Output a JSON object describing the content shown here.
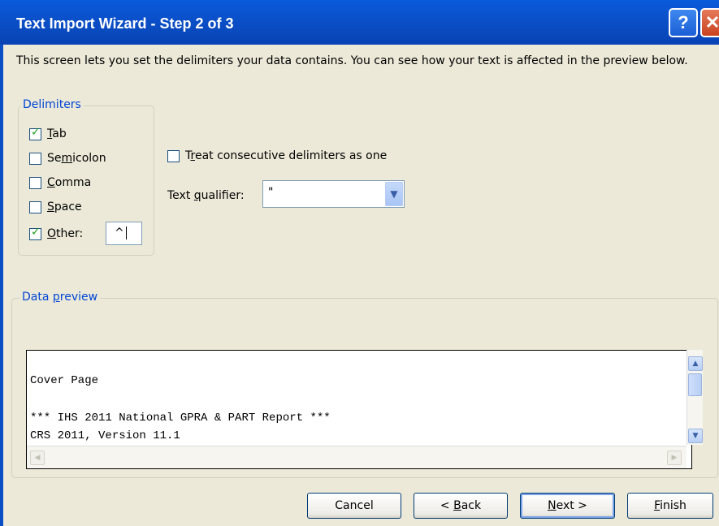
{
  "window": {
    "title": "Text Import Wizard - Step 2 of 3",
    "help_glyph": "?",
    "close_glyph": "✕"
  },
  "description": "This screen lets you set the delimiters your data contains.  You can see how your text is affected in the preview below.",
  "delimiters": {
    "legend": "Delimiters",
    "items": [
      {
        "key": "T",
        "rest": "ab",
        "checked": true
      },
      {
        "pre": "Se",
        "key": "m",
        "rest": "icolon",
        "checked": false
      },
      {
        "key": "C",
        "rest": "omma",
        "checked": false
      },
      {
        "key": "S",
        "rest": "pace",
        "checked": false
      },
      {
        "key": "O",
        "rest": "ther:",
        "checked": true
      }
    ],
    "other_value": "^"
  },
  "consecutive": {
    "pre": "T",
    "key": "r",
    "rest": "eat consecutive delimiters as one",
    "checked": false
  },
  "qualifier": {
    "pre": "Text ",
    "key": "q",
    "rest": "ualifier:",
    "value": "\""
  },
  "preview": {
    "legend_pre": "Data ",
    "legend_key": "p",
    "legend_rest": "review",
    "lines": [
      "",
      "Cover Page",
      "",
      "*** IHS 2011 National GPRA & PART Report ***",
      "CRS 2011, Version 11.1"
    ]
  },
  "buttons": {
    "cancel": "Cancel",
    "back_pre": "< ",
    "back_key": "B",
    "back_rest": "ack",
    "next_key": "N",
    "next_rest": "ext >",
    "finish_key": "F",
    "finish_rest": "inish"
  },
  "colors": {
    "titlebar": "#0a4ec6",
    "accent": "#0046d5",
    "check": "#21a121"
  }
}
